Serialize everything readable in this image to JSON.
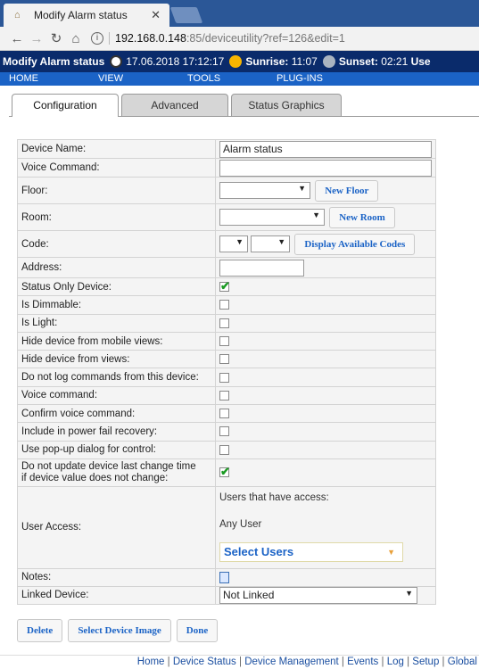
{
  "browser": {
    "tab_title": "Modify Alarm status",
    "url_host": "192.168.0.148",
    "url_path": ":85/deviceutility?ref=126&edit=1"
  },
  "header": {
    "title": "Modify Alarm status",
    "datetime": "17.06.2018 17:12:17",
    "sunrise_label": "Sunrise:",
    "sunrise_time": "11:07",
    "sunset_label": "Sunset:",
    "sunset_time": "02:21",
    "user_trunc": "Use"
  },
  "menu": [
    "HOME",
    "VIEW",
    "TOOLS",
    "PLUG-INS"
  ],
  "tabs": [
    "Configuration",
    "Advanced",
    "Status Graphics"
  ],
  "form": {
    "device_name_label": "Device Name:",
    "device_name_value": "Alarm status",
    "voice_command_label": "Voice Command:",
    "voice_command_value": "",
    "floor_label": "Floor:",
    "new_floor_button": "New Floor",
    "room_label": "Room:",
    "new_room_button": "New Room",
    "code_label": "Code:",
    "display_codes_button": "Display Available Codes",
    "address_label": "Address:",
    "address_value": "",
    "checkboxes": [
      {
        "label": "Status Only Device:",
        "checked": true
      },
      {
        "label": "Is Dimmable:",
        "checked": false
      },
      {
        "label": "Is Light:",
        "checked": false
      },
      {
        "label": "Hide device from mobile views:",
        "checked": false
      },
      {
        "label": "Hide device from views:",
        "checked": false
      },
      {
        "label": "Do not log commands from this device:",
        "checked": false
      },
      {
        "label": "Voice command:",
        "checked": false
      },
      {
        "label": "Confirm voice command:",
        "checked": false
      },
      {
        "label": "Include in power fail recovery:",
        "checked": false
      },
      {
        "label": "Use pop-up dialog for control:",
        "checked": false
      }
    ],
    "no_update_label_1": "Do not update device last change time",
    "no_update_label_2": "if device value does not change:",
    "no_update_checked": true,
    "user_access_label": "User Access:",
    "users_access_heading": "Users that have access:",
    "users_access_value": "Any User",
    "select_users": "Select Users",
    "notes_label": "Notes:",
    "linked_device_label": "Linked Device:",
    "linked_device_value": "Not Linked"
  },
  "buttons": {
    "delete": "Delete",
    "select_image": "Select Device Image",
    "done": "Done"
  },
  "footer": [
    "Home",
    "Device Status",
    "Device Management",
    "Events",
    "Log",
    "Setup",
    "Global"
  ],
  "colors": {
    "header_bg": "#0a2b6b",
    "menu_bg": "#1b63c6",
    "link": "#1b63c6",
    "check": "#1a9a22"
  }
}
